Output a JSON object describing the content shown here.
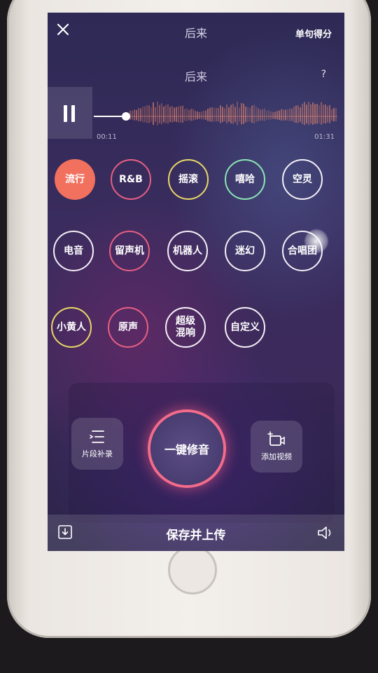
{
  "header": {
    "title": "后来",
    "score_label": "单句得分"
  },
  "song": {
    "title": "后来",
    "help_label": "?"
  },
  "player": {
    "current_time": "00:11",
    "total_time": "01:31",
    "progress": 0.12
  },
  "effects": [
    {
      "label": "流行",
      "selected": true
    },
    {
      "label": "R&B"
    },
    {
      "label": "摇滚"
    },
    {
      "label": "嘻哈"
    },
    {
      "label": "空灵"
    },
    {
      "label": "电音"
    },
    {
      "label": "留声机"
    },
    {
      "label": "机器人"
    },
    {
      "label": "迷幻"
    },
    {
      "label": "合唱团"
    },
    {
      "label": "小黄人"
    },
    {
      "label": "原声"
    },
    {
      "label": "超级混响"
    },
    {
      "label": "自定义"
    }
  ],
  "tools": {
    "segment_label": "片段补录",
    "main_label": "一键修音",
    "add_video_label": "添加视频"
  },
  "footer": {
    "save_label": "保存并上传"
  },
  "colors": {
    "selected": "#f2705e",
    "accent_pink": "#f26b8a",
    "waveform": "#e8876c"
  }
}
